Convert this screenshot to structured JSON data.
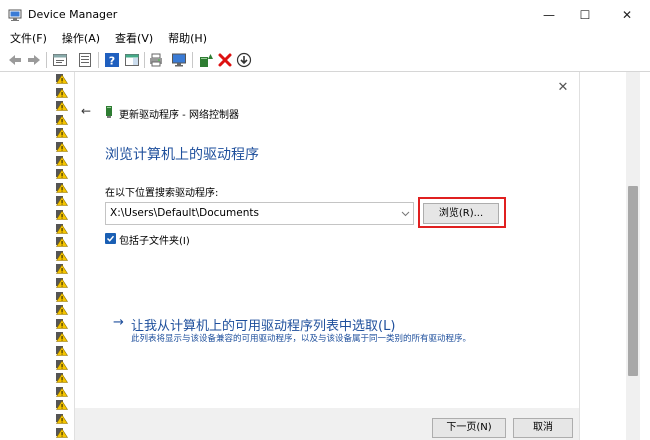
{
  "window": {
    "title": "Device Manager",
    "icon": "device-manager-icon",
    "controls": {
      "minimize": "—",
      "maximize": "☐",
      "close": "✕"
    }
  },
  "menu": [
    {
      "label": "文件(F)"
    },
    {
      "label": "操作(A)"
    },
    {
      "label": "查看(V)"
    },
    {
      "label": "帮助(H)"
    }
  ],
  "toolbar": {
    "icons": [
      "back-icon",
      "forward-icon",
      "properties-pane-icon",
      "device-list-icon",
      "help-icon",
      "action-pane-icon",
      "print-icon",
      "monitor-icon",
      "update-driver-icon",
      "uninstall-icon",
      "download-icon"
    ]
  },
  "dialog": {
    "close_glyph": "✕",
    "back_glyph": "←",
    "header_title": "更新驱动程序 - 网络控制器",
    "heading": "浏览计算机上的驱动程序",
    "search_label": "在以下位置搜索驱动程序:",
    "path_value": "X:\\Users\\Default\\Documents",
    "browse_label": "浏览(R)...",
    "checkbox_label": "包括子文件夹(I)",
    "checkbox_checked": true,
    "pick_arrow": "→",
    "pick_title": "让我从计算机上的可用驱动程序列表中选取(L)",
    "pick_desc": "此列表将显示与该设备兼容的可用驱动程序，以及与该设备属于同一类别的所有驱动程序。",
    "next_label": "下一页(N)",
    "cancel_label": "取消"
  },
  "colors": {
    "accent_blue": "#1e4f9c",
    "highlight_red": "#e02020",
    "warning_yellow": "#f5c400"
  }
}
